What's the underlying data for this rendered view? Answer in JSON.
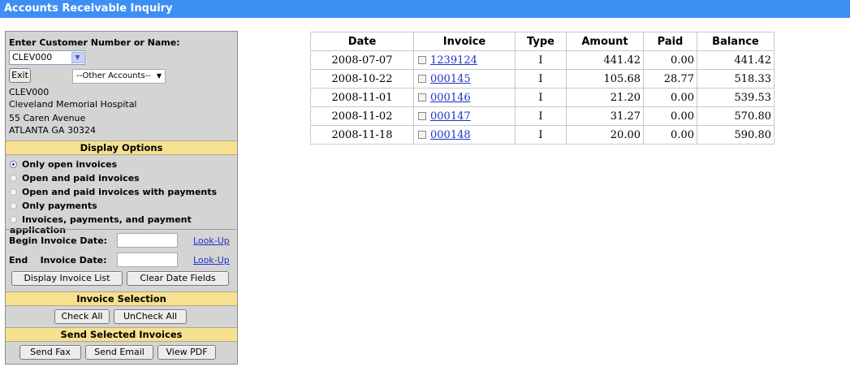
{
  "title": "Accounts Receivable Inquiry",
  "customer": {
    "prompt": "Enter Customer Number or Name:",
    "selected": "CLEV000",
    "exit_label": "Exit",
    "other_accounts": "--Other Accounts--",
    "number": "CLEV000",
    "name": "Cleveland Memorial Hospital",
    "address1": "55 Caren Avenue",
    "address2": "ATLANTA GA 30324"
  },
  "display_options": {
    "header": "Display Options",
    "options": [
      {
        "label": "Only open invoices",
        "selected": true
      },
      {
        "label": "Open and paid invoices",
        "selected": false
      },
      {
        "label": "Open and paid invoices with payments",
        "selected": false
      },
      {
        "label": "Only payments",
        "selected": false
      },
      {
        "label": "Invoices, payments, and payment application",
        "selected": false
      }
    ]
  },
  "dates": {
    "begin_label": "Begin Invoice Date:",
    "end_label_prefix": "End",
    "end_label": "Invoice Date:",
    "lookup_label": "Look-Up",
    "begin_value": "",
    "end_value": "",
    "display_button": "Display Invoice List",
    "clear_button": "Clear Date Fields"
  },
  "invoice_selection": {
    "header": "Invoice Selection",
    "check_all": "Check All",
    "uncheck_all": "UnCheck All"
  },
  "send": {
    "header": "Send Selected Invoices",
    "fax": "Send Fax",
    "email": "Send Email",
    "pdf": "View PDF"
  },
  "table": {
    "headers": [
      "Date",
      "Invoice",
      "Type",
      "Amount",
      "Paid",
      "Balance"
    ],
    "rows": [
      {
        "date": "2008-07-07",
        "invoice": "1239124",
        "type": "I",
        "amount": "441.42",
        "paid": "0.00",
        "balance": "441.42"
      },
      {
        "date": "2008-10-22",
        "invoice": "000145",
        "type": "I",
        "amount": "105.68",
        "paid": "28.77",
        "balance": "518.33"
      },
      {
        "date": "2008-11-01",
        "invoice": "000146",
        "type": "I",
        "amount": "21.20",
        "paid": "0.00",
        "balance": "539.53"
      },
      {
        "date": "2008-11-02",
        "invoice": "000147",
        "type": "I",
        "amount": "31.27",
        "paid": "0.00",
        "balance": "570.80"
      },
      {
        "date": "2008-11-18",
        "invoice": "000148",
        "type": "I",
        "amount": "20.00",
        "paid": "0.00",
        "balance": "590.80"
      }
    ]
  }
}
